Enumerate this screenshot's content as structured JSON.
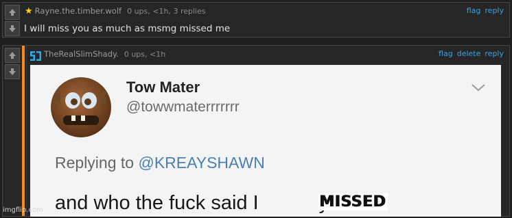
{
  "comments": [
    {
      "username": "Rayne.the.timber.wolf",
      "meta": "0 ups, <1h, 3 replies",
      "badge_icon": "star-icon",
      "text": "I will miss you as much as msmg missed me",
      "links": [
        "flag",
        "reply"
      ]
    },
    {
      "username": "TheRealSlimShady.",
      "meta": "0 ups, <1h",
      "avatar_icon": "mod-logo-icon",
      "links": [
        "flag",
        "delete",
        "reply"
      ],
      "image": {
        "tweet_name": "Tow Mater",
        "tweet_handle": "@towwmaterrrrrrr",
        "replying_prefix": "Replying to ",
        "replying_mention": "@KREAYSHAWN",
        "tweet_text": "and who the fuck said I",
        "tweet_text_end": "you?",
        "overlay": "MISSED"
      }
    }
  ],
  "watermark": "imgflip.com",
  "colors": {
    "accent": "#f68a1e",
    "link": "#3aa4e0",
    "star": "#ffd400"
  }
}
